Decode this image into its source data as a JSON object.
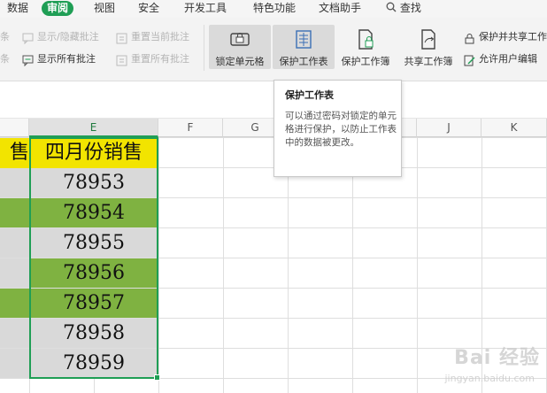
{
  "menubar": {
    "items": [
      {
        "label": "数据"
      },
      {
        "label": "审阅",
        "active": true
      },
      {
        "label": "视图"
      },
      {
        "label": "安全"
      },
      {
        "label": "开发工具"
      },
      {
        "label": "特色功能"
      },
      {
        "label": "文档助手"
      }
    ],
    "search_label": "查找"
  },
  "ribbon": {
    "row1": {
      "partial_left": "条",
      "show_hide_comment": "显示/隐藏批注",
      "reset_current_comment": "重置当前批注"
    },
    "row2": {
      "partial_left": "条",
      "show_all_comments": "显示所有批注",
      "reset_all_comments": "重置所有批注"
    },
    "big_buttons": {
      "lock_cell": "锁定单元格",
      "protect_sheet": "保护工作表",
      "protect_workbook": "保护工作簿",
      "share_workbook": "共享工作簿"
    },
    "right": {
      "protect_and_share": "保护并共享工作",
      "allow_user_edit": "允许用户编辑"
    }
  },
  "tooltip": {
    "title": "保护工作表",
    "body": "可以通过密码对锁定的单元格进行保护，以防止工作表中的数据被更改。"
  },
  "columns": [
    "E",
    "F",
    "G",
    "H",
    "I",
    "J",
    "K"
  ],
  "sheet": {
    "header_left": "售",
    "header_main": "四月份销售",
    "values": [
      "78953",
      "78954",
      "78955",
      "78956",
      "78957",
      "78958",
      "78959"
    ],
    "row_fills": [
      "gray",
      "green",
      "gray",
      "green",
      "green",
      "gray",
      "gray"
    ],
    "left_fills": [
      "gray",
      "green",
      "gray",
      "gray",
      "green",
      "gray",
      "gray"
    ]
  },
  "colors": {
    "accent_green": "#1f9e55",
    "fill_green": "#7fb241",
    "fill_gray": "#d9d9d9",
    "header_yellow": "#f2e400"
  },
  "watermark": {
    "main": "Bai 经验",
    "sub": "jingyan.baidu.com"
  }
}
